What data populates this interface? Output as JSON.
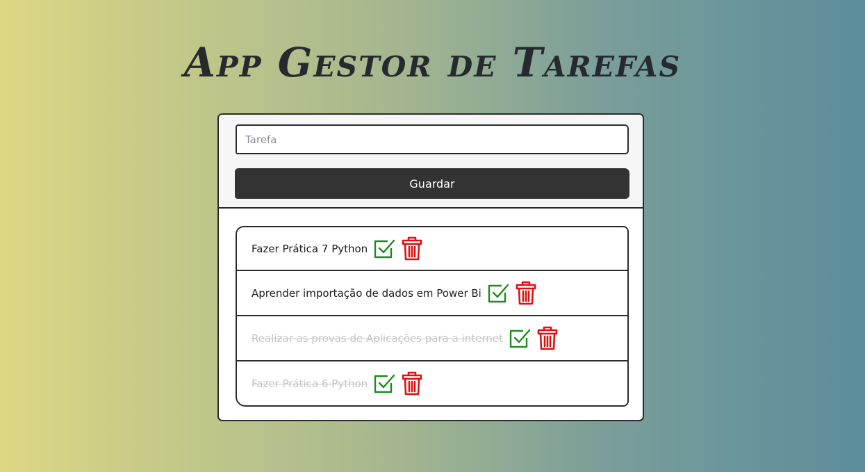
{
  "app": {
    "title": "App Gestor de Tarefas"
  },
  "form": {
    "input_placeholder": "Tarefa",
    "input_value": "",
    "save_label": "Guardar"
  },
  "colors": {
    "check": "#1e8a1e",
    "trash": "#e01010",
    "button_bg": "#333333"
  },
  "tasks": [
    {
      "text": "Fazer Prática 7 Python",
      "done": false
    },
    {
      "text": "Aprender importação de dados em Power Bi",
      "done": false
    },
    {
      "text": "Realizar as provas de Aplicações para a internet",
      "done": true
    },
    {
      "text": "Fazer Prática 6 Python",
      "done": true
    }
  ],
  "icons": {
    "complete": "check-square-icon",
    "delete": "trash-icon"
  }
}
